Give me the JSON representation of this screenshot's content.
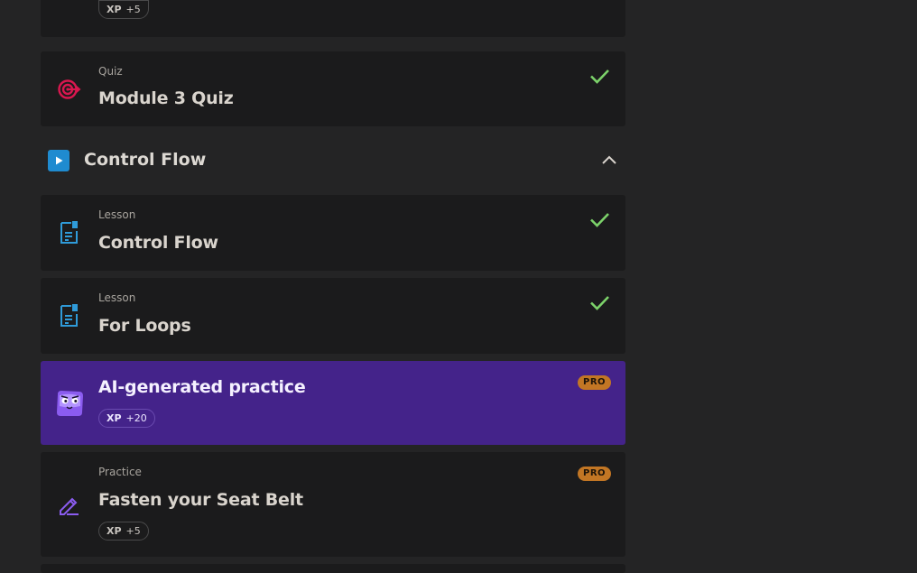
{
  "top_card": {
    "xp_label": "XP",
    "xp_value": "+5"
  },
  "quiz_card": {
    "kind": "Quiz",
    "title": "Module 3 Quiz",
    "completed": true,
    "icon": "target-icon"
  },
  "section": {
    "title": "Control Flow",
    "icon": "play-icon",
    "expanded": true
  },
  "lessons": [
    {
      "kind": "Lesson",
      "title": "Control Flow",
      "completed": true,
      "icon": "document-icon"
    },
    {
      "kind": "Lesson",
      "title": "For Loops",
      "completed": true,
      "icon": "document-icon"
    }
  ],
  "ai_practice": {
    "title": "AI-generated practice",
    "badge": "PRO",
    "xp_label": "XP",
    "xp_value": "+20",
    "icon": "mascot-icon"
  },
  "practice": {
    "kind": "Practice",
    "title": "Fasten your Seat Belt",
    "badge": "PRO",
    "xp_label": "XP",
    "xp_value": "+5",
    "icon": "pencil-icon"
  },
  "colors": {
    "accent_check": "#7cd26a",
    "ai_card_bg": "#44238a",
    "pro_badge": "#c27624",
    "quiz_icon": "#d9174f",
    "doc_icon": "#2f9bd9"
  }
}
